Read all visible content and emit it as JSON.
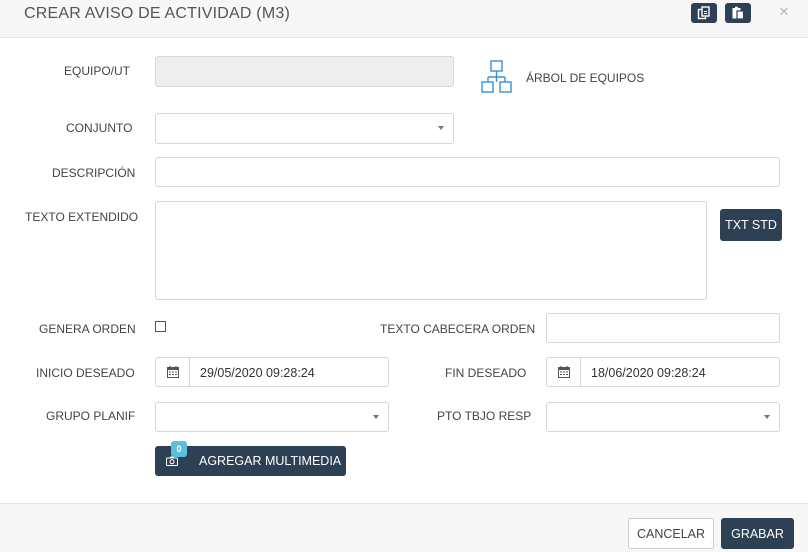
{
  "header": {
    "title": "CREAR AVISO DE ACTIVIDAD (M3)",
    "close_symbol": "×"
  },
  "form": {
    "equipo_label": "EQUIPO/UT",
    "equipo_value": "",
    "arbol_label": "ÁRBOL DE EQUIPOS",
    "conjunto_label": "CONJUNTO",
    "conjunto_value": "",
    "descripcion_label": "DESCRIPCIÓN",
    "descripcion_value": "",
    "texto_extendido_label": "TEXTO EXTENDIDO",
    "texto_extendido_value": "",
    "txt_std_label": "TXT STD",
    "genera_orden_label": "GENERA ORDEN",
    "genera_orden_checked": false,
    "texto_cabecera_label": "TEXTO CABECERA ORDEN",
    "texto_cabecera_value": "",
    "inicio_label": "INICIO DESEADO",
    "inicio_value": "29/05/2020 09:28:24",
    "fin_label": "FIN DESEADO",
    "fin_value": "18/06/2020 09:28:24",
    "grupo_label": "GRUPO PLANIF",
    "grupo_value": "",
    "pto_label": "PTO TBJO RESP",
    "pto_value": "",
    "multimedia_label": "AGREGAR MULTIMEDIA",
    "multimedia_count": "0"
  },
  "footer": {
    "cancel_label": "CANCELAR",
    "save_label": "GRABAR"
  },
  "colors": {
    "dark_button": "#2e4053",
    "badge": "#5bc0de",
    "tree_icon": "#3a8fd8"
  },
  "icons": {
    "copy": "copy-icon",
    "paste": "paste-icon",
    "tree": "tree-structure-icon",
    "calendar": "calendar-icon",
    "camera": "camera-icon"
  }
}
